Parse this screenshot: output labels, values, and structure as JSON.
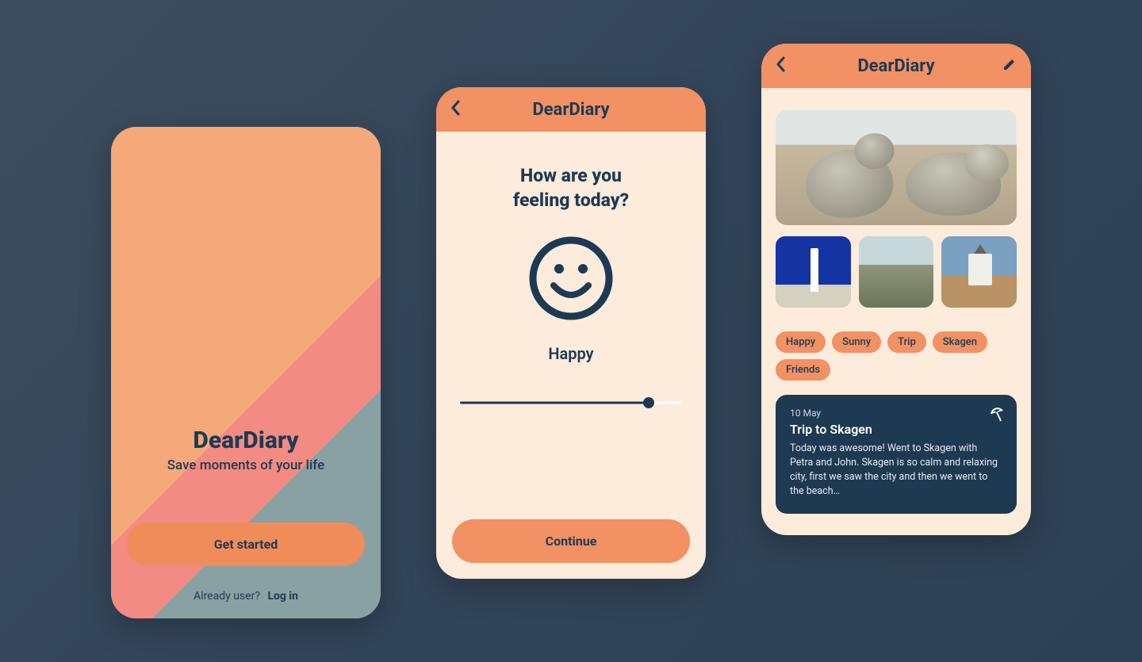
{
  "colors": {
    "accent": "#f19164",
    "accentLight": "#f5a97a",
    "pink": "#f28b82",
    "sage": "#8aa1a3",
    "cream": "#fdebdc",
    "navy": "#1d3a53",
    "entry_bg": "#1e3952"
  },
  "welcome": {
    "title": "DearDiary",
    "subtitle": "Save moments of your life",
    "cta": "Get started",
    "prompt": "Already user?",
    "login": "Log in"
  },
  "mood": {
    "app_title": "DearDiary",
    "question_line1": "How are you",
    "question_line2": "feeling today?",
    "mood_label": "Happy",
    "slider_value": 85,
    "cta": "Continue"
  },
  "diary": {
    "app_title": "DearDiary",
    "tags": [
      "Happy",
      "Sunny",
      "Trip",
      "Skagen",
      "Friends"
    ],
    "entry": {
      "date": "10 May",
      "title": "Trip to Skagen",
      "text": "Today was awesome! Went to Skagen with Petra and John. Skagen is so calm and relaxing city, first we saw the city and then we went to the beach…",
      "weather_icon": "beach-umbrella"
    }
  }
}
